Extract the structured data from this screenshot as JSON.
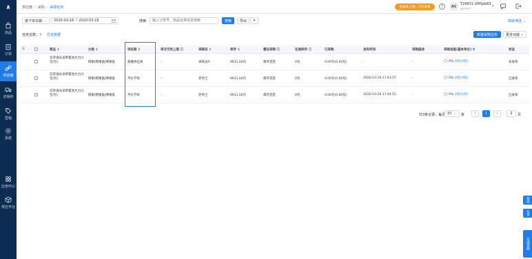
{
  "sidebar": {
    "logo": "∧",
    "items": [
      {
        "label": "商品",
        "icon": "bag-icon"
      },
      {
        "label": "订单",
        "icon": "clipboard-icon"
      },
      {
        "label": "供应链",
        "icon": "link-icon"
      },
      {
        "label": "进销存",
        "icon": "truck-icon"
      },
      {
        "label": "营销",
        "icon": "tag-icon"
      },
      {
        "label": "系统",
        "icon": "gear-icon"
      },
      {
        "label": "应用中心",
        "icon": "apps-icon"
      },
      {
        "label": "供应平台",
        "icon": "box-icon"
      }
    ]
  },
  "header": {
    "breadcrumb": [
      "供应链",
      "采购",
      "采购任务"
    ],
    "promo": "商品来上线，点击查看",
    "help_label": "?",
    "avatar_initials": "AV",
    "user_name": "T29831 GMSpb83",
    "user_code": "gmhlv3"
  },
  "filters": {
    "date_type": "按下单日期",
    "date_range": "2020-03-18 ~ 2020-03-18",
    "search_label": "搜索:",
    "search_placeholder": "输入订单号、商品名称信息搜索",
    "search_button": "搜索",
    "export_button": "导出",
    "advanced": "高级筛选"
  },
  "toolbar": {
    "task_count_label": "任务总数：",
    "task_count": "3",
    "history": "历史数据",
    "new_button": "新建采购任务",
    "more_button": "更多功能"
  },
  "table": {
    "columns": [
      "商品",
      "分类",
      "供应商",
      "单次可供上限",
      "采购员",
      "库存",
      "建议采购",
      "在途库存",
      "已采购",
      "发布时间",
      "采购描述",
      "采购进度(基本单位)",
      "状态"
    ],
    "rows": [
      {
        "product": "云开境光洋草量洛大力(1包/包)",
        "category": "网果|网果类|网果类",
        "supplier": "部维供应商",
        "limit": "-",
        "buyer": "采购员A",
        "stock": "9911.00包",
        "suggest": "库存充足",
        "transit": "0包",
        "purchased": "0.00包(0.00包)",
        "time": "-",
        "desc": "-",
        "progress": "0%",
        "progress_text": "(0包/4包)",
        "status": "未发布"
      },
      {
        "product": "云开境光洋草量洛大力(1包/包)",
        "category": "网果|网果类|网果类",
        "supplier": "平价学校",
        "limit": "-",
        "buyer": "老师士",
        "stock": "9911.00包",
        "suggest": "库存充足",
        "transit": "0包",
        "purchased": "0.00包(0.00包)",
        "time": "2020-03-18 17:43:57",
        "desc": "-",
        "progress": "0%",
        "progress_text": "(0包/4包)",
        "status": "已发布"
      },
      {
        "product": "云开境光洋草量洛大力(1包/包)",
        "category": "网果|网果类|网果类",
        "supplier": "平价学校",
        "limit": "-",
        "buyer": "老师士",
        "stock": "9911.00包",
        "suggest": "库存充足",
        "transit": "0包",
        "purchased": "0.00包(0.00包)",
        "time": "2020-03-18 17:44:51",
        "desc": "-",
        "progress": "0%",
        "progress_text": "(0包/2包)",
        "status": "已发布"
      }
    ]
  },
  "pagination": {
    "summary": "共3条记录，每页",
    "page_size": "10",
    "unit": "条",
    "prev": "‹",
    "current": "1",
    "next": "›",
    "jump_value": "1",
    "jump_label": "页"
  },
  "side_tabs": [
    "帮助",
    "任务",
    "在线客服"
  ],
  "colors": {
    "primary": "#1f7ce8",
    "sidebar": "#0d2c52",
    "promo": "#f59a23"
  }
}
